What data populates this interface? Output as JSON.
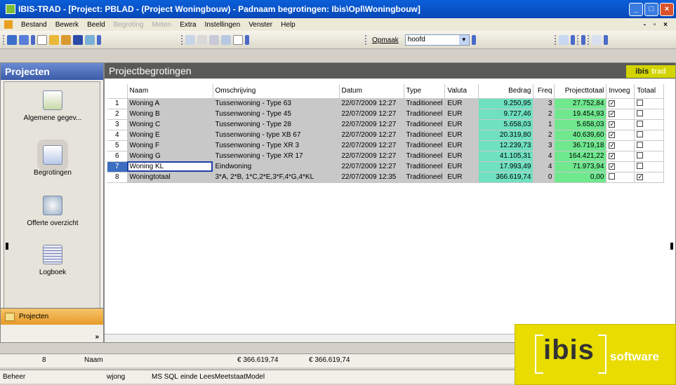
{
  "window": {
    "title": "IBIS-TRAD - [Project: PBLAD - (Project Woningbouw) - Padnaam begrotingen: Ibis\\Opl\\Woningbouw]"
  },
  "menu": {
    "items": [
      {
        "label": "Bestand",
        "enabled": true
      },
      {
        "label": "Bewerk",
        "enabled": true
      },
      {
        "label": "Beeld",
        "enabled": true
      },
      {
        "label": "Begroting",
        "enabled": false
      },
      {
        "label": "Meten",
        "enabled": false
      },
      {
        "label": "Extra",
        "enabled": true
      },
      {
        "label": "Instellingen",
        "enabled": true
      },
      {
        "label": "Venster",
        "enabled": true
      },
      {
        "label": "Help",
        "enabled": true
      }
    ],
    "mdi_controls": "- ▫ ×"
  },
  "toolbar": {
    "opmaak_label": "Opmaak",
    "opmaak_value": "hoofd"
  },
  "sidebar": {
    "title": "Projecten",
    "items": [
      {
        "label": "Algemene gegev..."
      },
      {
        "label": "Begrotingen"
      },
      {
        "label": "Offerte overzicht"
      },
      {
        "label": "Logboek"
      }
    ],
    "bottom_label": "Projecten",
    "chevron": "»"
  },
  "main": {
    "title": "Projectbegrotingen",
    "badge_ibis": "ibis",
    "badge_trad": "trad",
    "columns": [
      "",
      "Naam",
      "Omschrijving",
      "Datum",
      "Type",
      "Valuta",
      "Bedrag",
      "Freq",
      "Projecttotaal",
      "Invoeg",
      "Totaal"
    ],
    "rows": [
      {
        "n": "1",
        "naam": "Woning A",
        "oms": "Tussenwoning - Type 63",
        "datum": "22/07/2009 12:27",
        "type": "Traditioneel",
        "valuta": "EUR",
        "bedrag": "9.250,95",
        "freq": "3",
        "proj": "27.752,84",
        "invoeg": true,
        "totaal": false
      },
      {
        "n": "2",
        "naam": "Woning B",
        "oms": "Tussenwoning - Type 45",
        "datum": "22/07/2009 12:27",
        "type": "Traditioneel",
        "valuta": "EUR",
        "bedrag": "9.727,46",
        "freq": "2",
        "proj": "19.454,93",
        "invoeg": true,
        "totaal": false
      },
      {
        "n": "3",
        "naam": "Woning C",
        "oms": "Tussenwoning - Type 28",
        "datum": "22/07/2009 12:27",
        "type": "Traditioneel",
        "valuta": "EUR",
        "bedrag": "5.658,03",
        "freq": "1",
        "proj": "5.658,03",
        "invoeg": true,
        "totaal": false
      },
      {
        "n": "4",
        "naam": "Woning E",
        "oms": "Tussenwoning - type XB 67",
        "datum": "22/07/2009 12:27",
        "type": "Traditioneel",
        "valuta": "EUR",
        "bedrag": "20.319,80",
        "freq": "2",
        "proj": "40.639,60",
        "invoeg": true,
        "totaal": false
      },
      {
        "n": "5",
        "naam": "Woning F",
        "oms": "Tussenwoning - Type XR 3",
        "datum": "22/07/2009 12:27",
        "type": "Traditioneel",
        "valuta": "EUR",
        "bedrag": "12.239,73",
        "freq": "3",
        "proj": "36.719,18",
        "invoeg": true,
        "totaal": false
      },
      {
        "n": "6",
        "naam": "Woning G",
        "oms": "Tussenwoning - Type XR 17",
        "datum": "22/07/2009 12:27",
        "type": "Traditioneel",
        "valuta": "EUR",
        "bedrag": "41.105,31",
        "freq": "4",
        "proj": "164.421,22",
        "invoeg": true,
        "totaal": false
      },
      {
        "n": "7",
        "naam": "Woning KL",
        "oms": "Eindwoning",
        "datum": "22/07/2009 12:27",
        "type": "Traditioneel",
        "valuta": "EUR",
        "bedrag": "17.993,49",
        "freq": "4",
        "proj": "71.973,94",
        "invoeg": true,
        "totaal": false,
        "selected": true
      },
      {
        "n": "8",
        "naam": "Woningtotaal",
        "oms": "3*A, 2*B, 1*C,2*E,3*F,4*G,4*KL",
        "datum": "22/07/2009 12:35",
        "type": "Traditioneel",
        "valuta": "EUR",
        "bedrag": "366.619,74",
        "freq": "0",
        "proj": "0,00",
        "invoeg": false,
        "totaal": true
      }
    ]
  },
  "status": {
    "count": "8",
    "field": "Naam",
    "sum1": "€ 366.619,74",
    "sum2": "€ 366.619,74",
    "mode": "Beheer",
    "user": "wjong",
    "db": "MS SQL",
    "msg": "einde LeesMeetstaatModel"
  },
  "logo": {
    "brand": "ibis",
    "sub": "software"
  },
  "colors": {
    "title": "#0a5fd8",
    "bedrag": "#6fe0c0",
    "projecttotaal": "#6fe88e",
    "logo": "#e8dc00",
    "selected_row": "#3b6ec0"
  }
}
